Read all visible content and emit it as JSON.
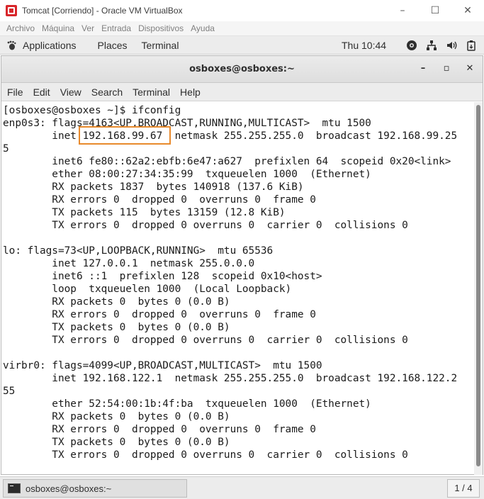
{
  "host_window": {
    "title": "Tomcat [Corriendo] - Oracle VM VirtualBox",
    "controls": [
      "–",
      "☐",
      "✕"
    ]
  },
  "vbox_menu": [
    "Archivo",
    "Máquina",
    "Ver",
    "Entrada",
    "Dispositivos",
    "Ayuda"
  ],
  "gnome_panel": {
    "applications": "Applications",
    "places": "Places",
    "terminal": "Terminal",
    "clock": "Thu 10:44",
    "icons": [
      "accessibility-icon",
      "network-icon",
      "volume-icon",
      "clipboard-icon"
    ]
  },
  "terminal_window": {
    "title": "osboxes@osboxes:~",
    "controls": [
      "–",
      "▫",
      "✕"
    ],
    "menu": [
      "File",
      "Edit",
      "View",
      "Search",
      "Terminal",
      "Help"
    ],
    "lines": [
      "[osboxes@osboxes ~]$ ifconfig",
      "enp0s3: flags=4163<UP,BROADCAST,RUNNING,MULTICAST>  mtu 1500",
      "        inet 192.168.99.67  netmask 255.255.255.0  broadcast 192.168.99.25",
      "5",
      "        inet6 fe80::62a2:ebfb:6e47:a627  prefixlen 64  scopeid 0x20<link>",
      "        ether 08:00:27:34:35:99  txqueuelen 1000  (Ethernet)",
      "        RX packets 1837  bytes 140918 (137.6 KiB)",
      "        RX errors 0  dropped 0  overruns 0  frame 0",
      "        TX packets 115  bytes 13159 (12.8 KiB)",
      "        TX errors 0  dropped 0 overruns 0  carrier 0  collisions 0",
      "",
      "lo: flags=73<UP,LOOPBACK,RUNNING>  mtu 65536",
      "        inet 127.0.0.1  netmask 255.0.0.0",
      "        inet6 ::1  prefixlen 128  scopeid 0x10<host>",
      "        loop  txqueuelen 1000  (Local Loopback)",
      "        RX packets 0  bytes 0 (0.0 B)",
      "        RX errors 0  dropped 0  overruns 0  frame 0",
      "        TX packets 0  bytes 0 (0.0 B)",
      "        TX errors 0  dropped 0 overruns 0  carrier 0  collisions 0",
      "",
      "virbr0: flags=4099<UP,BROADCAST,MULTICAST>  mtu 1500",
      "        inet 192.168.122.1  netmask 255.255.255.0  broadcast 192.168.122.2",
      "55",
      "        ether 52:54:00:1b:4f:ba  txqueuelen 1000  (Ethernet)",
      "        RX packets 0  bytes 0 (0.0 B)",
      "        RX errors 0  dropped 0  overruns 0  frame 0",
      "        TX packets 0  bytes 0 (0.0 B)",
      "        TX errors 0  dropped 0 overruns 0  carrier 0  collisions 0"
    ]
  },
  "taskbar": {
    "task_label": "osboxes@osboxes:~",
    "workspace": "1 / 4"
  },
  "colors": {
    "highlight": "#e88a2c",
    "terminal_text": "#1a1a1a",
    "panel_bg": "#ececec"
  }
}
